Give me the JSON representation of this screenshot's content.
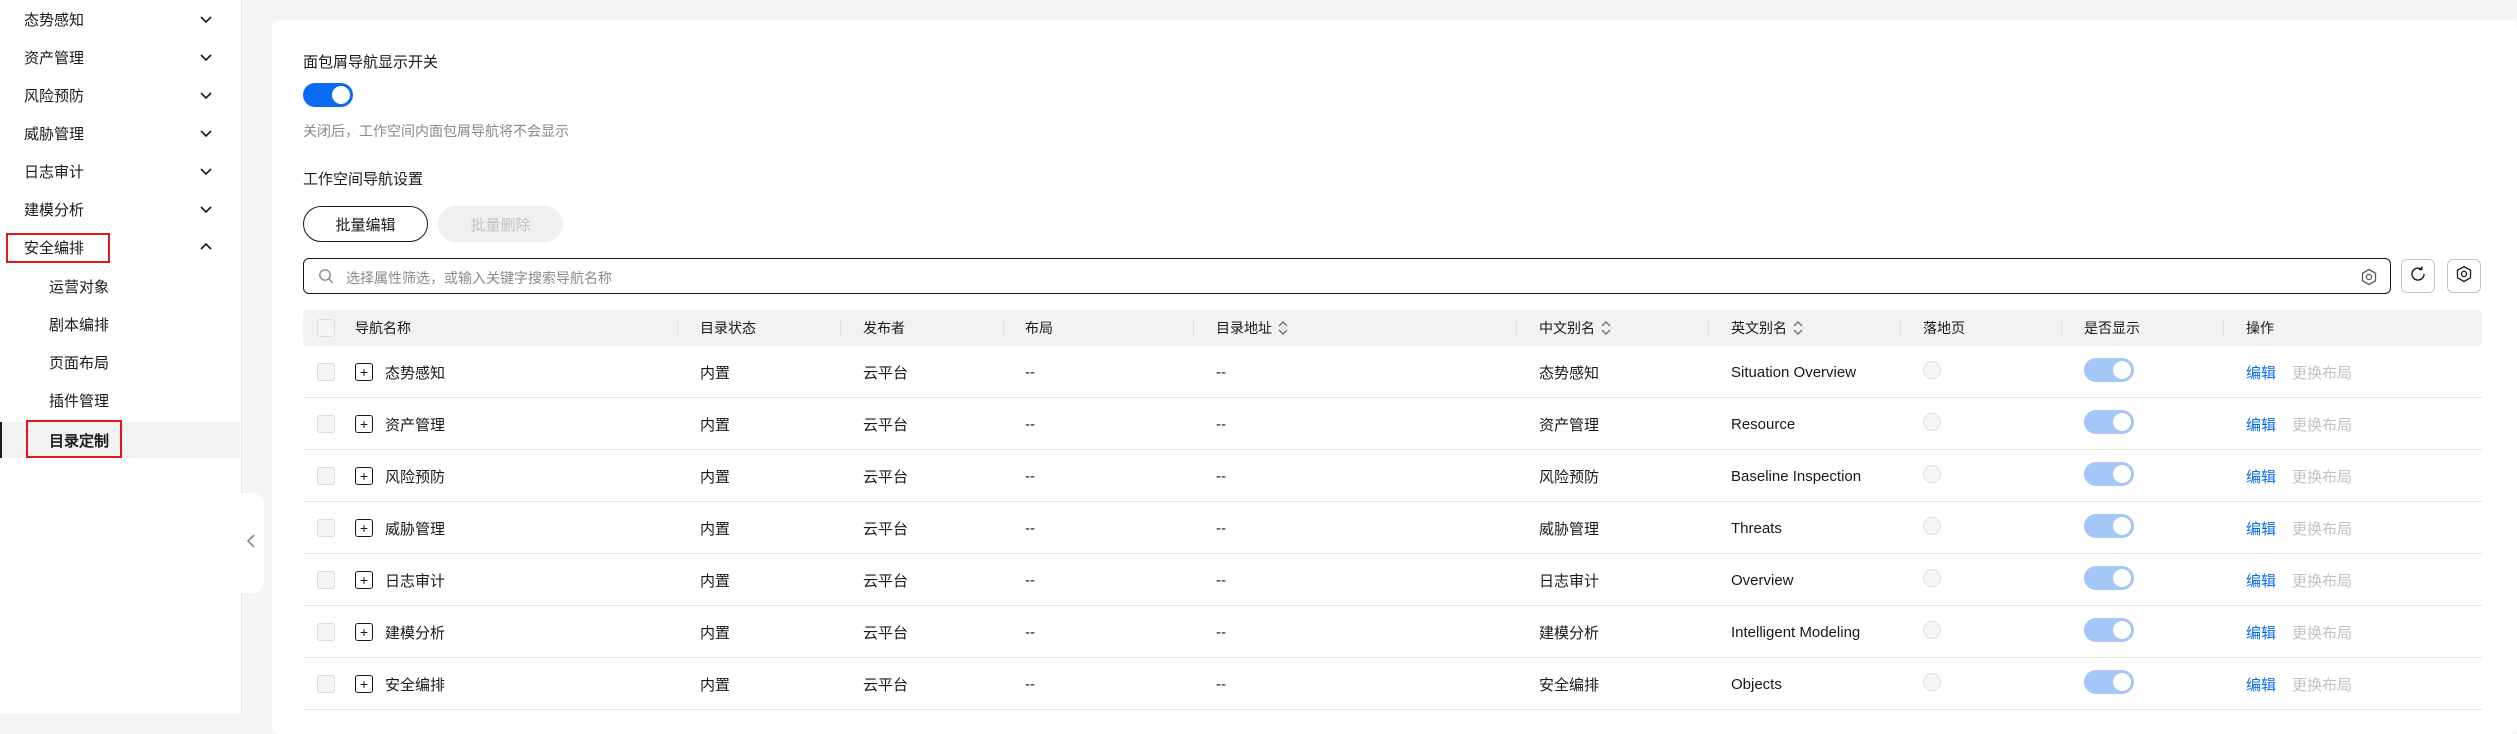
{
  "sidebar": {
    "items": [
      {
        "label": "态势感知",
        "expanded": false
      },
      {
        "label": "资产管理",
        "expanded": false
      },
      {
        "label": "风险预防",
        "expanded": false
      },
      {
        "label": "威胁管理",
        "expanded": false
      },
      {
        "label": "日志审计",
        "expanded": false
      },
      {
        "label": "建模分析",
        "expanded": false
      },
      {
        "label": "安全编排",
        "expanded": true
      }
    ],
    "sub_items": [
      {
        "label": "运营对象",
        "active": false
      },
      {
        "label": "剧本编排",
        "active": false
      },
      {
        "label": "页面布局",
        "active": false
      },
      {
        "label": "插件管理",
        "active": false
      },
      {
        "label": "目录定制",
        "active": true
      }
    ]
  },
  "settings": {
    "breadcrumb_switch_title": "面包屑导航显示开关",
    "breadcrumb_switch_on": true,
    "breadcrumb_hint": "关闭后，工作空间内面包屑导航将不会显示",
    "workspace_nav_title": "工作空间导航设置"
  },
  "toolbar": {
    "batch_edit": "批量编辑",
    "batch_delete": "批量删除"
  },
  "search": {
    "placeholder": "选择属性筛选，或输入关键字搜索导航名称"
  },
  "table": {
    "headers": [
      "导航名称",
      "目录状态",
      "发布者",
      "布局",
      "目录地址",
      "中文别名",
      "英文别名",
      "落地页",
      "是否显示",
      "操作"
    ],
    "rows": [
      {
        "name": "态势感知",
        "status": "内置",
        "publisher": "云平台",
        "layout": "--",
        "address": "--",
        "cn_alias": "态势感知",
        "en_alias": "Situation Overview",
        "show": true,
        "edit": "编辑",
        "change_layout": "更换布局"
      },
      {
        "name": "资产管理",
        "status": "内置",
        "publisher": "云平台",
        "layout": "--",
        "address": "--",
        "cn_alias": "资产管理",
        "en_alias": "Resource",
        "show": true,
        "edit": "编辑",
        "change_layout": "更换布局"
      },
      {
        "name": "风险预防",
        "status": "内置",
        "publisher": "云平台",
        "layout": "--",
        "address": "--",
        "cn_alias": "风险预防",
        "en_alias": "Baseline Inspection",
        "show": true,
        "edit": "编辑",
        "change_layout": "更换布局"
      },
      {
        "name": "威胁管理",
        "status": "内置",
        "publisher": "云平台",
        "layout": "--",
        "address": "--",
        "cn_alias": "威胁管理",
        "en_alias": "Threats",
        "show": true,
        "edit": "编辑",
        "change_layout": "更换布局"
      },
      {
        "name": "日志审计",
        "status": "内置",
        "publisher": "云平台",
        "layout": "--",
        "address": "--",
        "cn_alias": "日志审计",
        "en_alias": "Overview",
        "show": true,
        "edit": "编辑",
        "change_layout": "更换布局"
      },
      {
        "name": "建模分析",
        "status": "内置",
        "publisher": "云平台",
        "layout": "--",
        "address": "--",
        "cn_alias": "建模分析",
        "en_alias": "Intelligent Modeling",
        "show": true,
        "edit": "编辑",
        "change_layout": "更换布局"
      },
      {
        "name": "安全编排",
        "status": "内置",
        "publisher": "云平台",
        "layout": "--",
        "address": "--",
        "cn_alias": "安全编排",
        "en_alias": "Objects",
        "show": true,
        "edit": "编辑",
        "change_layout": "更换布局"
      }
    ]
  },
  "colors": {
    "accent": "#0a6cf5",
    "highlight_box": "#e4151b"
  },
  "icons": {
    "chevron_down": "chevron-down-icon",
    "chevron_up": "chevron-up-icon",
    "collapse": "chevron-left-icon",
    "search": "search-icon",
    "refresh": "refresh-icon",
    "settings": "gear-icon"
  }
}
